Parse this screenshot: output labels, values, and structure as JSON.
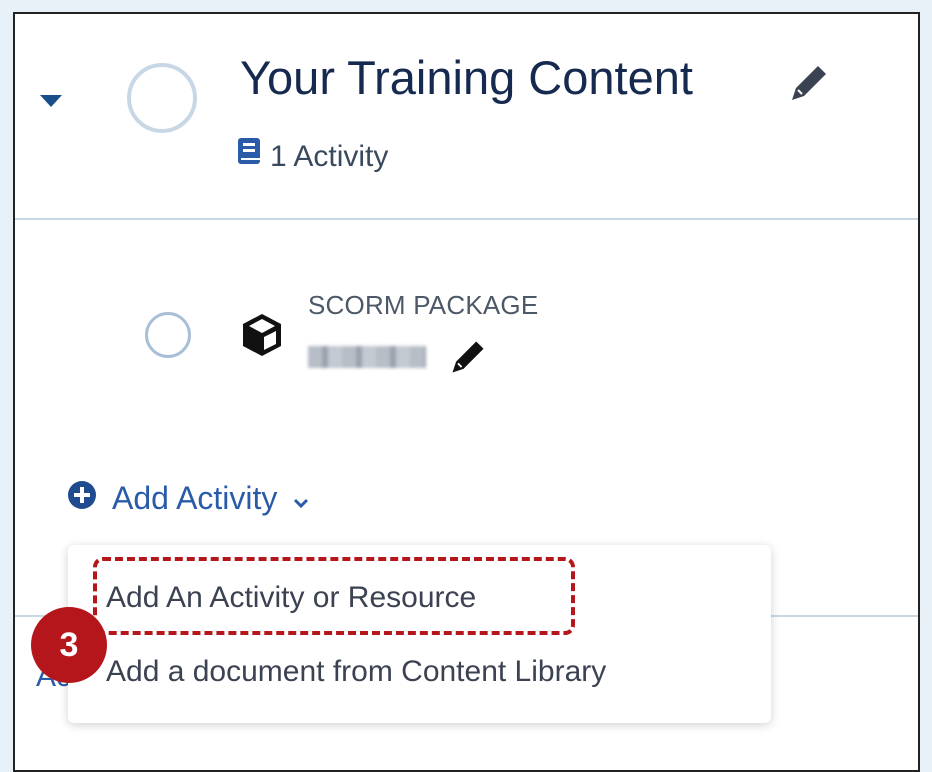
{
  "section": {
    "title": "Your Training Content",
    "activity_count": "1 Activity"
  },
  "activity": {
    "type_label": "SCORM PACKAGE",
    "name": "redacted"
  },
  "add_activity": {
    "label": "Add Activity"
  },
  "dropdown": {
    "items": [
      "Add An Activity or Resource",
      "Add a document from Content Library"
    ]
  },
  "partially_hidden_text": "Ac",
  "callout": {
    "step": "3"
  },
  "colors": {
    "accent": "#2a5ba8",
    "title": "#152a4e",
    "highlight": "#b5161b",
    "background": "#e9f1f8"
  }
}
